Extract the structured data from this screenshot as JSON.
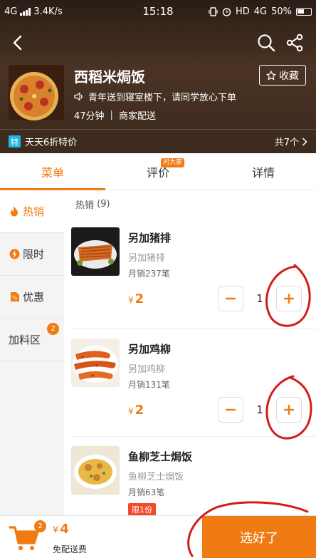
{
  "status_bar": {
    "network": "4G",
    "speed": "3.4K/s",
    "time": "15:18",
    "hd_label": "HD",
    "net2": "4G",
    "battery": "50%"
  },
  "store": {
    "name": "西稻米焗饭",
    "favorite_label": "收藏",
    "notice": "青年送到寝室楼下，请同学放心下单",
    "delivery_time": "47分钟",
    "delivery_mode": "商家配送",
    "promo_tag": "特",
    "promo_text": "天天6折特价",
    "promo_count": "共7个"
  },
  "tabs": [
    {
      "label": "菜单",
      "active": true
    },
    {
      "label": "评价",
      "badge": "问大家"
    },
    {
      "label": "详情"
    }
  ],
  "sidebar": [
    {
      "label": "热销",
      "icon": "flame-icon",
      "active": true
    },
    {
      "label": "限时",
      "icon": "lightning-icon"
    },
    {
      "label": "优惠",
      "icon": "percent-icon"
    },
    {
      "label": "加料区",
      "badge": "2"
    }
  ],
  "section": {
    "title": "热销",
    "count": "(9)"
  },
  "items": [
    {
      "name": "另加猪排",
      "desc": "另加猪排",
      "sold": "月销237笔",
      "currency": "¥",
      "price": "2",
      "qty": "1"
    },
    {
      "name": "另加鸡柳",
      "desc": "另加鸡柳",
      "sold": "月销131笔",
      "currency": "¥",
      "price": "2",
      "qty": "1"
    },
    {
      "name": "鱼柳芝士焗饭",
      "desc": "鱼柳芝士焗饭",
      "sold": "月销63笔",
      "limit": "限1份"
    }
  ],
  "cart": {
    "badge": "2",
    "currency": "¥",
    "total": "4",
    "free_delivery": "免配送费",
    "checkout_label": "选好了"
  },
  "colors": {
    "accent": "#f07b13",
    "annotation": "#d21c1c"
  }
}
